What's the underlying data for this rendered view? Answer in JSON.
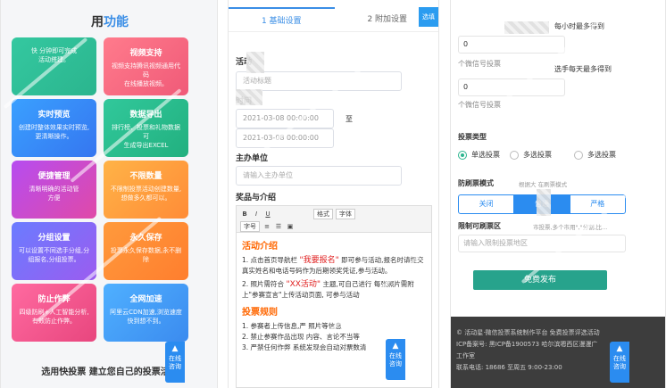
{
  "screen1": {
    "title_prefix": "用",
    "title_accent": "功能",
    "cards": [
      {
        "title": "",
        "desc": "快 分钟即可完成\n活动搭建。"
      },
      {
        "title": "视频支持",
        "desc": "视频支持腾讯视频通用代码\n在线播放视频。"
      },
      {
        "title": "实时预览",
        "desc": "创建时整体效果实时预览,\n更清晰操作。"
      },
      {
        "title": "数据导出",
        "desc": "排行榜、投票和礼物数据可\n生成导出EXCEL"
      },
      {
        "title": "便捷管理",
        "desc": "清晰明确的活动管\n方便"
      },
      {
        "title": "不限数量",
        "desc": "不限制投票活动创建数量,\n想做多久都可以。"
      },
      {
        "title": "分组设置",
        "desc": "可以设置不同选手分组,分\n组报名,分组投票。"
      },
      {
        "title": "永久保存",
        "desc": "投票永久保存数据,永不删\n除"
      },
      {
        "title": "防止作弊",
        "desc": "四级防刷+人工智能分析,\n有效防止作弊。"
      },
      {
        "title": "全网加速",
        "desc": "阿里云CDN加速,浏览速度\n快到想不到。"
      }
    ],
    "footer": "选用快投票 建立您自己的投票活动",
    "chat_label_1": "在线",
    "chat_label_2": "咨询"
  },
  "screen2": {
    "tabs": [
      "1 基础设置",
      "2 附加设置"
    ],
    "corner": "选填",
    "activity_label": "活动",
    "activity_placeholder": "活动标题",
    "time_label": "时间",
    "start_value": "2021-03-08 00:00:00",
    "to_label": "至",
    "end_value": "2021-03-08 00:00:00",
    "organizer_label": "主办单位",
    "organizer_placeholder": "请输入主办单位",
    "prize_label": "奖品与介绍",
    "toolbar": {
      "bold": "B",
      "italic": "I",
      "underline": "U",
      "format": "格式",
      "font": "字体",
      "size": "字号"
    },
    "section1": "活动介绍",
    "p1_a": "1. 点击首页导航栏 ",
    "p1_red": "\"我要报名\"",
    "p1_b": " 即可参与活动,报名时请提交真实姓名和电话号码作为后期领奖凭证,参与活动。",
    "p2_a": "2. 照片需符合 ",
    "p2_red": "\"XX活动\"",
    "p2_b": " 主题,可自己进行 每张照片需附上\"参赛宣言\"上传活动页面, 可参与活动",
    "section2": "投票规则",
    "r1": "1. 参赛者上传信息,严 照片等信息",
    "r2": "2. 禁止参赛作品出现 内容、言论不当等",
    "r3": "3. 严禁任何作弊 系统发现会自动对票数清",
    "chat_label_1": "在线",
    "chat_label_2": "咨询"
  },
  "screen3": {
    "hour_label": "每小时最多得到",
    "val1": "0",
    "val1_hint": "个微信号投票",
    "day_label": "选手每天最多得到",
    "val2": "0",
    "val2_hint": "个微信号投票",
    "vote_type_label": "投票类型",
    "radio_single": "单选投票",
    "radio_multi": "多选投票",
    "radio_multi2": "多选投票",
    "anti_label": "防刷票模式",
    "anti_hint": "根据大  在刷票模式",
    "seg": [
      "关闭",
      "普通",
      "严格"
    ],
    "limit_label": "限制可刷票区",
    "limit_placeholder": "请输入限制投票地区",
    "limit_hint": "市投票,多个市用\",\"分割,比...",
    "publish": "免费发布",
    "footer_line1": "© 活动星·微信投票系统制作平台 免费投票评选活动",
    "footer_line2": "ICP备案号: 黑ICP备1900573 哈尔滨嗯西区漫漫广",
    "footer_line3": "工作室",
    "footer_line4": "联系电话: 18686  至周五 9:00-23:00",
    "chat_label_1": "在线",
    "chat_label_2": "咨询"
  }
}
